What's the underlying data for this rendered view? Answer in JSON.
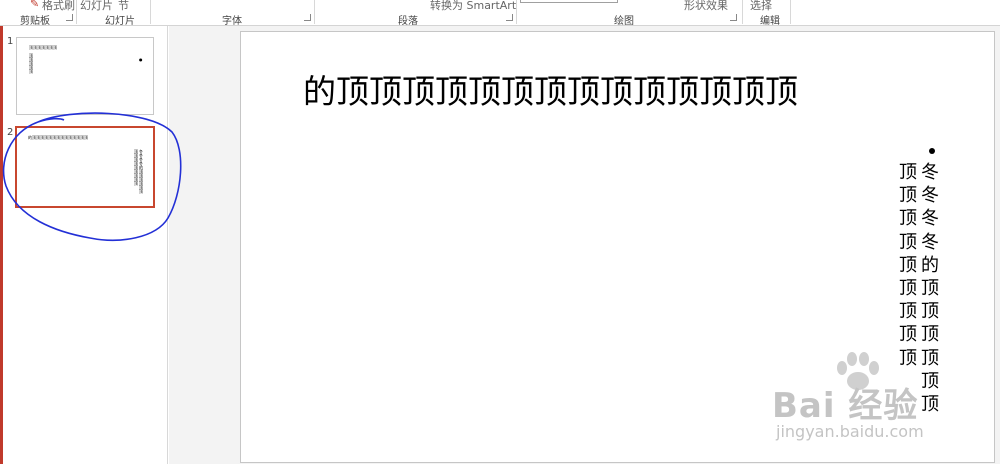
{
  "ribbon": {
    "groups": [
      "剪贴板",
      "幻灯片",
      "字体",
      "段落",
      "绘图",
      "编辑"
    ],
    "cut_labels": [
      "格式刷",
      "幻灯片",
      "节",
      "转换为 SmartArt",
      "形状效果",
      "选择"
    ]
  },
  "thumbnails": [
    {
      "number": "1",
      "selected": false
    },
    {
      "number": "2",
      "selected": true
    }
  ],
  "slide": {
    "title": "的顶顶顶顶顶顶顶顶顶顶顶顶顶顶",
    "bullet_columns": [
      "冬冬冬冬的顶顶顶顶顶顶",
      "顶顶顶顶顶顶顶顶顶"
    ]
  },
  "colors": {
    "selection_border": "#c8472f",
    "annotation": "#2330d6",
    "frame": "#c0392b"
  },
  "watermark": {
    "main": "Bai 经验",
    "url": "jingyan.baidu.com"
  }
}
